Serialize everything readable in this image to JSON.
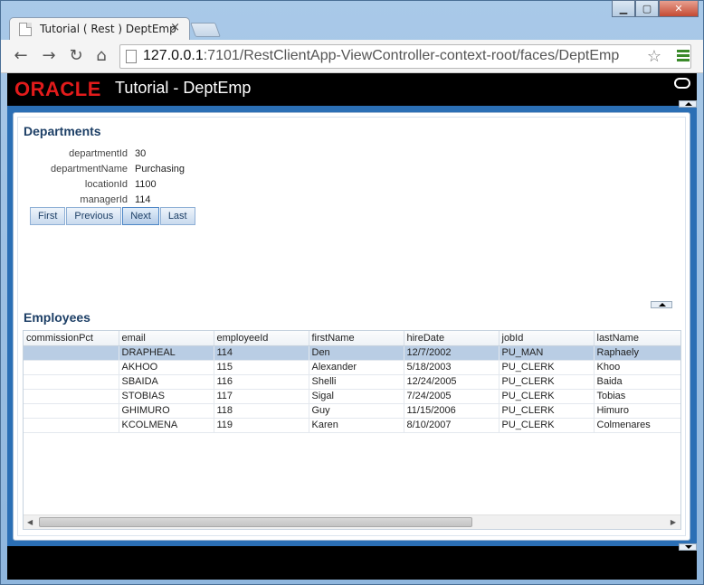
{
  "browser": {
    "tab_title": "Tutorial ( Rest ) DeptEmp",
    "tab_close": "×",
    "url_host": "127.0.0.1",
    "url_rest": ":7101/RestClientApp-ViewController-context-root/faces/DeptEmp",
    "back": "←",
    "forward": "→",
    "reload": "↻",
    "home": "⌂",
    "star": "☆",
    "win_min": "▁",
    "win_max": "▢",
    "win_close": "✕"
  },
  "header": {
    "brand": "ORACLE",
    "title": "Tutorial - DeptEmp"
  },
  "departments": {
    "heading": "Departments",
    "fields": [
      {
        "label": "departmentId",
        "value": "30"
      },
      {
        "label": "departmentName",
        "value": "Purchasing"
      },
      {
        "label": "locationId",
        "value": "1100"
      },
      {
        "label": "managerId",
        "value": "114"
      }
    ],
    "buttons": {
      "first": "First",
      "previous": "Previous",
      "next": "Next",
      "last": "Last"
    }
  },
  "employees": {
    "heading": "Employees",
    "columns": [
      "commissionPct",
      "email",
      "employeeId",
      "firstName",
      "hireDate",
      "jobId",
      "lastName"
    ],
    "rows": [
      [
        "",
        "DRAPHEAL",
        "114",
        "Den",
        "12/7/2002",
        "PU_MAN",
        "Raphaely"
      ],
      [
        "",
        "AKHOO",
        "115",
        "Alexander",
        "5/18/2003",
        "PU_CLERK",
        "Khoo"
      ],
      [
        "",
        "SBAIDA",
        "116",
        "Shelli",
        "12/24/2005",
        "PU_CLERK",
        "Baida"
      ],
      [
        "",
        "STOBIAS",
        "117",
        "Sigal",
        "7/24/2005",
        "PU_CLERK",
        "Tobias"
      ],
      [
        "",
        "GHIMURO",
        "118",
        "Guy",
        "11/15/2006",
        "PU_CLERK",
        "Himuro"
      ],
      [
        "",
        "KCOLMENA",
        "119",
        "Karen",
        "8/10/2007",
        "PU_CLERK",
        "Colmenares"
      ]
    ],
    "selected_row": 0,
    "scroll_left": "◀",
    "scroll_right": "▶"
  }
}
